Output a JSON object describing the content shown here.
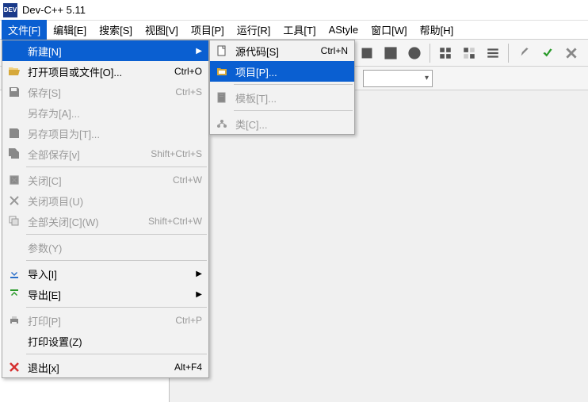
{
  "title": "Dev-C++ 5.11",
  "menubar": [
    "文件[F]",
    "编辑[E]",
    "搜索[S]",
    "视图[V]",
    "项目[P]",
    "运行[R]",
    "工具[T]",
    "AStyle",
    "窗口[W]",
    "帮助[H]"
  ],
  "file_menu": {
    "new": {
      "label": "新建[N]"
    },
    "open": {
      "label": "打开项目或文件[O]...",
      "shortcut": "Ctrl+O"
    },
    "save": {
      "label": "保存[S]",
      "shortcut": "Ctrl+S"
    },
    "save_as": {
      "label": "另存为[A]...",
      "shortcut": ""
    },
    "save_project_as": {
      "label": "另存项目为[T]...",
      "shortcut": ""
    },
    "save_all": {
      "label": "全部保存[v]",
      "shortcut": "Shift+Ctrl+S"
    },
    "close": {
      "label": "关闭[C]",
      "shortcut": "Ctrl+W"
    },
    "close_project": {
      "label": "关闭项目(U)",
      "shortcut": ""
    },
    "close_all": {
      "label": "全部关闭[C](W)",
      "shortcut": "Shift+Ctrl+W"
    },
    "params": {
      "label": "参数(Y)",
      "shortcut": ""
    },
    "import": {
      "label": "导入[I]"
    },
    "export": {
      "label": "导出[E]"
    },
    "print": {
      "label": "打印[P]",
      "shortcut": "Ctrl+P"
    },
    "print_setup": {
      "label": "打印设置(Z)",
      "shortcut": ""
    },
    "exit": {
      "label": "退出[x]",
      "shortcut": "Alt+F4"
    }
  },
  "new_submenu": {
    "source": {
      "label": "源代码[S]",
      "shortcut": "Ctrl+N"
    },
    "project": {
      "label": "项目[P]..."
    },
    "template": {
      "label": "模板[T]..."
    },
    "class": {
      "label": "类[C]..."
    }
  }
}
